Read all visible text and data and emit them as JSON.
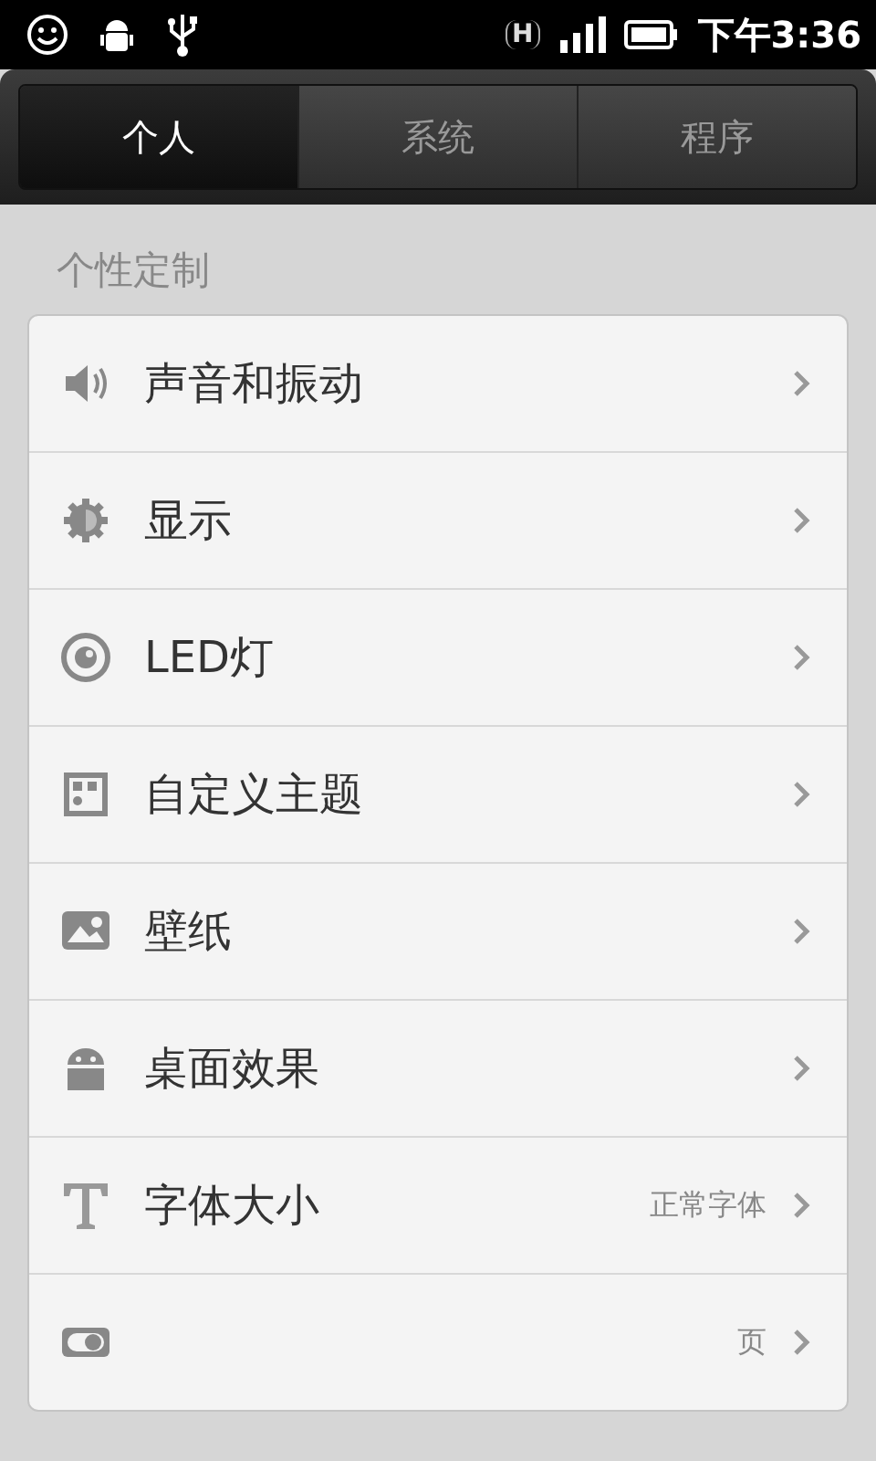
{
  "status_bar": {
    "network": "H",
    "time": "下午3:36"
  },
  "tabs": [
    {
      "label": "个人",
      "selected": true
    },
    {
      "label": "系统",
      "selected": false
    },
    {
      "label": "程序",
      "selected": false
    }
  ],
  "section": {
    "title": "个性定制"
  },
  "items": [
    {
      "label": "声音和振动"
    },
    {
      "label": "显示"
    },
    {
      "label": "LED灯"
    },
    {
      "label": "自定义主题"
    },
    {
      "label": "壁纸"
    },
    {
      "label": "桌面效果"
    },
    {
      "label": "字体大小",
      "value": "正常字体"
    },
    {
      "value": "页"
    }
  ]
}
